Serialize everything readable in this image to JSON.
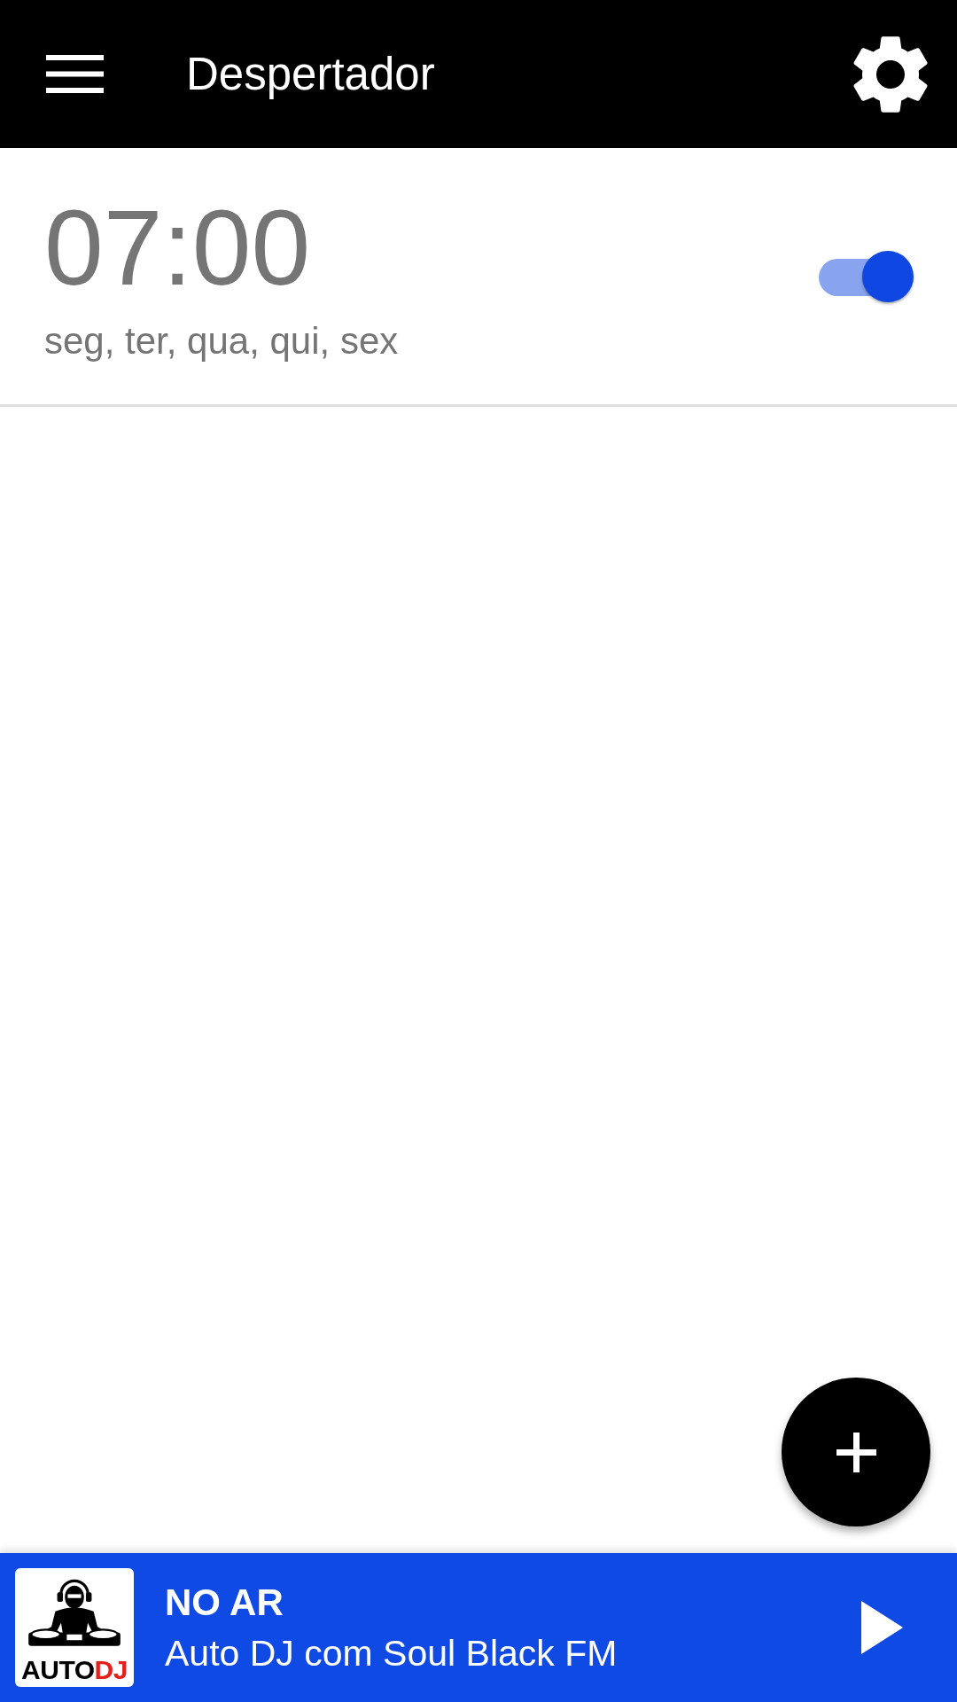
{
  "app_bar": {
    "title": "Despertador"
  },
  "alarms": [
    {
      "time": "07:00",
      "days": "seg, ter, qua, qui, sex",
      "on": true
    }
  ],
  "player": {
    "logo": {
      "text_parts": [
        {
          "text": "AUTO",
          "color": "#000000"
        },
        {
          "text": "DJ",
          "color": "#e3211b"
        }
      ]
    },
    "status": "NO AR",
    "title": "Auto DJ com Soul Black FM"
  }
}
